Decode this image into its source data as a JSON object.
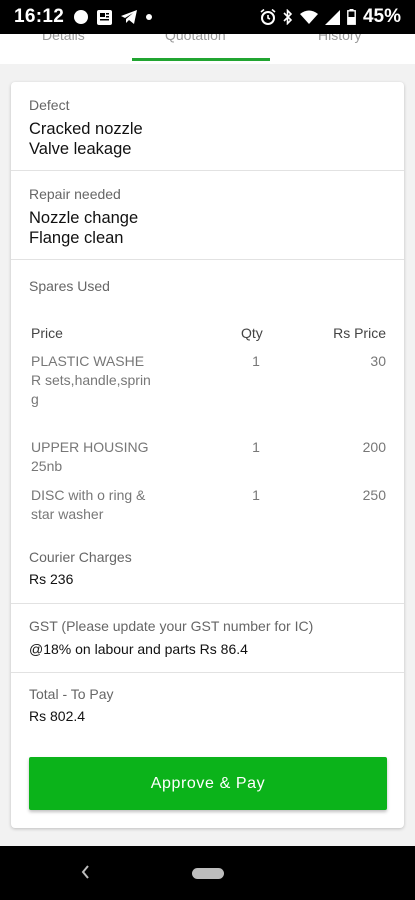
{
  "status_bar": {
    "time": "16:12",
    "battery": "45%",
    "left_icons": [
      "notification-dot-icon",
      "news-icon",
      "telegram-icon",
      "dot-icon"
    ],
    "right_icons": [
      "alarm-icon",
      "bluetooth-icon",
      "wifi-icon",
      "signal-icon",
      "battery-icon"
    ]
  },
  "tabs": {
    "items": [
      {
        "label": "Details"
      },
      {
        "label": "Quotation"
      },
      {
        "label": "History"
      }
    ],
    "active": "Quotation",
    "accent": "#21a531"
  },
  "defect": {
    "label": "Defect",
    "lines": [
      "Cracked nozzle",
      "Valve leakage"
    ]
  },
  "repair": {
    "label": "Repair needed",
    "lines": [
      "Nozzle change",
      "Flange clean"
    ]
  },
  "spares": {
    "label": "Spares Used",
    "headers": {
      "name": "Price",
      "qty": "Qty",
      "price": "Rs Price"
    },
    "rows": [
      {
        "name": "PLASTIC WASHER sets,handle,spring",
        "qty": "1",
        "price": "30"
      },
      {
        "name": "UPPER HOUSING 25nb",
        "qty": "1",
        "price": "200"
      },
      {
        "name": "DISC with o ring & star washer",
        "qty": "1",
        "price": "250"
      }
    ]
  },
  "courier": {
    "label": "Courier Charges",
    "value": "Rs 236"
  },
  "gst": {
    "label": "GST (Please update your GST number for IC)",
    "value": "@18% on labour and parts Rs 86.4"
  },
  "total": {
    "label": "Total - To Pay",
    "value": "Rs 802.4"
  },
  "pay_button": {
    "label": "Approve & Pay",
    "color": "#0bb31a"
  }
}
